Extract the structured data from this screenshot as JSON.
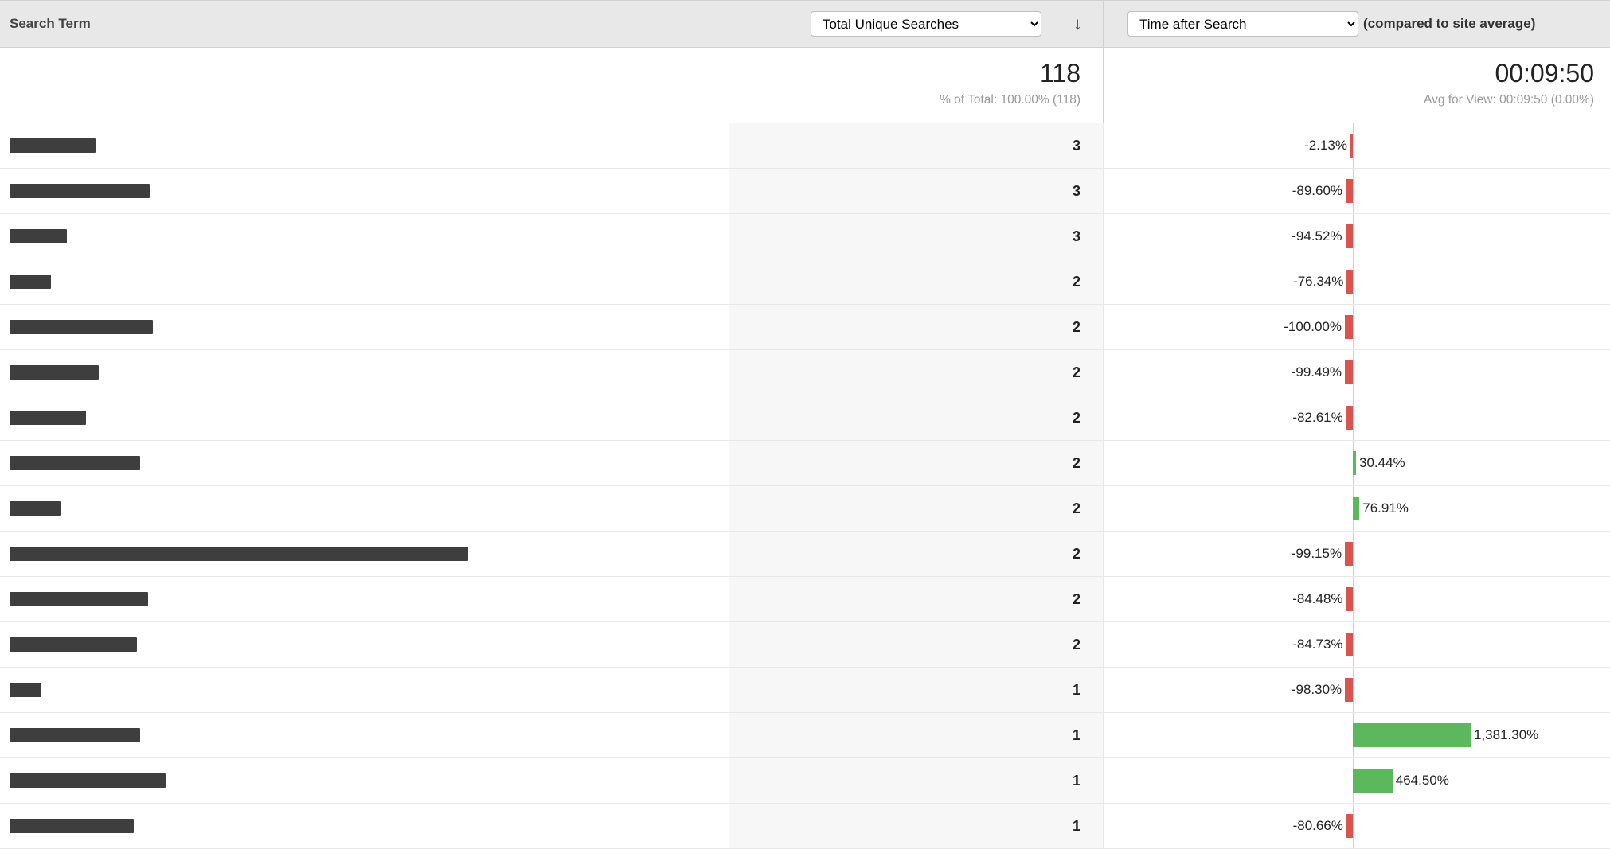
{
  "header": {
    "term_label": "Search Term",
    "metric1_selected": "Total Unique Searches",
    "metric2_selected": "Time after Search",
    "compared_text": "(compared to site average)"
  },
  "summary": {
    "total_value": "118",
    "total_subtext": "% of Total: 100.00% (118)",
    "time_value": "00:09:50",
    "time_subtext": "Avg for View: 00:09:50 (0.00%)"
  },
  "bar_max_positive_pct": 1400,
  "rows": [
    {
      "term_redact_w": 108,
      "count": "3",
      "pct_num": -2.13,
      "pct_label": "-2.13%"
    },
    {
      "term_redact_w": 176,
      "count": "3",
      "pct_num": -89.6,
      "pct_label": "-89.60%"
    },
    {
      "term_redact_w": 72,
      "count": "3",
      "pct_num": -94.52,
      "pct_label": "-94.52%"
    },
    {
      "term_redact_w": 52,
      "count": "2",
      "pct_num": -76.34,
      "pct_label": "-76.34%"
    },
    {
      "term_redact_w": 180,
      "count": "2",
      "pct_num": -100.0,
      "pct_label": "-100.00%"
    },
    {
      "term_redact_w": 112,
      "count": "2",
      "pct_num": -99.49,
      "pct_label": "-99.49%"
    },
    {
      "term_redact_w": 96,
      "count": "2",
      "pct_num": -82.61,
      "pct_label": "-82.61%"
    },
    {
      "term_redact_w": 164,
      "count": "2",
      "pct_num": 30.44,
      "pct_label": "30.44%"
    },
    {
      "term_redact_w": 64,
      "count": "2",
      "pct_num": 76.91,
      "pct_label": "76.91%"
    },
    {
      "term_redact_w": 576,
      "count": "2",
      "pct_num": -99.15,
      "pct_label": "-99.15%"
    },
    {
      "term_redact_w": 174,
      "count": "2",
      "pct_num": -84.48,
      "pct_label": "-84.48%"
    },
    {
      "term_redact_w": 160,
      "count": "2",
      "pct_num": -84.73,
      "pct_label": "-84.73%"
    },
    {
      "term_redact_w": 40,
      "count": "1",
      "pct_num": -98.3,
      "pct_label": "-98.30%"
    },
    {
      "term_redact_w": 164,
      "count": "1",
      "pct_num": 1381.3,
      "pct_label": "1,381.30%"
    },
    {
      "term_redact_w": 196,
      "count": "1",
      "pct_num": 464.5,
      "pct_label": "464.50%"
    },
    {
      "term_redact_w": 156,
      "count": "1",
      "pct_num": -80.66,
      "pct_label": "-80.66%"
    }
  ]
}
